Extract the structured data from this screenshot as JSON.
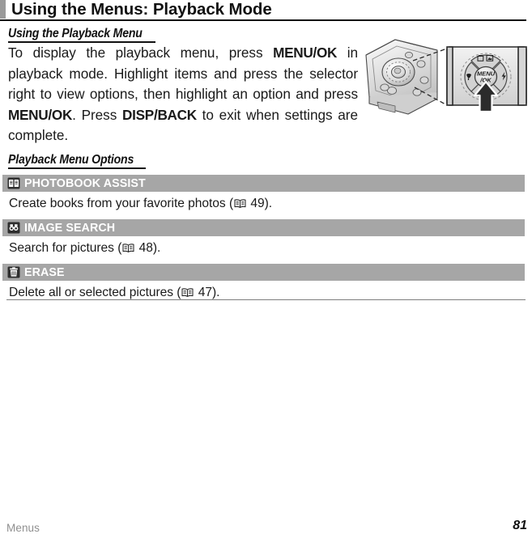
{
  "page": {
    "chapter_title": "Using the Menus: Playback Mode",
    "footer_section": "Menus",
    "footer_page_number": "81"
  },
  "sections": {
    "playback_menu": {
      "heading": "Using the Playback Menu",
      "body_part1": "To display the playback menu, press ",
      "body_bold1": "MENU/OK",
      "body_part2": " in playback mode.  Highlight items and press the selector right to view options, then highlight an option and press ",
      "body_bold2": "MENU/OK",
      "body_part3": ".  Press ",
      "body_bold3": "DISP/BACK",
      "body_part4": " to exit when settings are complete."
    },
    "menu_options": {
      "heading": "Playback Menu Options"
    }
  },
  "menu_items": [
    {
      "icon": "photobook-icon",
      "label": "PHOTOBOOK ASSIST",
      "desc_prefix": "Create books from your favorite photos (",
      "page_ref": " 49",
      "desc_suffix": ")."
    },
    {
      "icon": "image-search-icon",
      "label": "IMAGE SEARCH",
      "desc_prefix": "Search for pictures (",
      "page_ref": " 48",
      "desc_suffix": ")."
    },
    {
      "icon": "erase-trash-icon",
      "label": "ERASE",
      "desc_prefix": "Delete all or selected pictures (",
      "page_ref": " 47",
      "desc_suffix": ")."
    }
  ],
  "illustration": {
    "name": "camera-rear-menu-ok-callout",
    "button_label_line1": "MENU",
    "button_label_line2": "OK"
  },
  "colors": {
    "menu_bar_gray": "#a6a6a6",
    "title_tab_gray": "#9a9a9a",
    "footer_gray": "#8f8f8f",
    "text_black": "#1a1a1a"
  }
}
